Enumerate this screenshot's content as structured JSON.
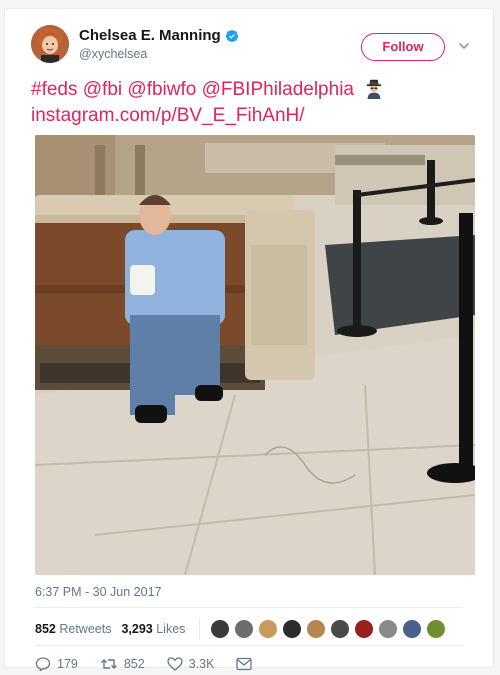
{
  "author": {
    "display_name": "Chelsea E. Manning",
    "handle": "@xychelsea",
    "verified": true,
    "avatar_icon": "profile-photo"
  },
  "follow_button": {
    "label": "Follow"
  },
  "tweet": {
    "hashtag": "#feds",
    "mentions": [
      "@fbi",
      "@fbiwfo",
      "@FBIPhiladelphia"
    ],
    "emoji_icon": "sleuth-spy-icon",
    "link": "instagram.com/p/BV_E_FihAnH/",
    "timestamp": "6:37 PM - 30 Jun 2017"
  },
  "stats": {
    "retweets_count": "852",
    "retweets_label": "Retweets",
    "likes_count": "3,293",
    "likes_label": "Likes",
    "liker_avatar_count": 10
  },
  "actions": {
    "reply_count": "179",
    "retweet_count": "852",
    "like_count": "3.3K"
  },
  "colors": {
    "accent": "#e0245e",
    "verified": "#1da1f2",
    "muted": "#657786",
    "text": "#14171a",
    "border": "#e6ecf0"
  }
}
